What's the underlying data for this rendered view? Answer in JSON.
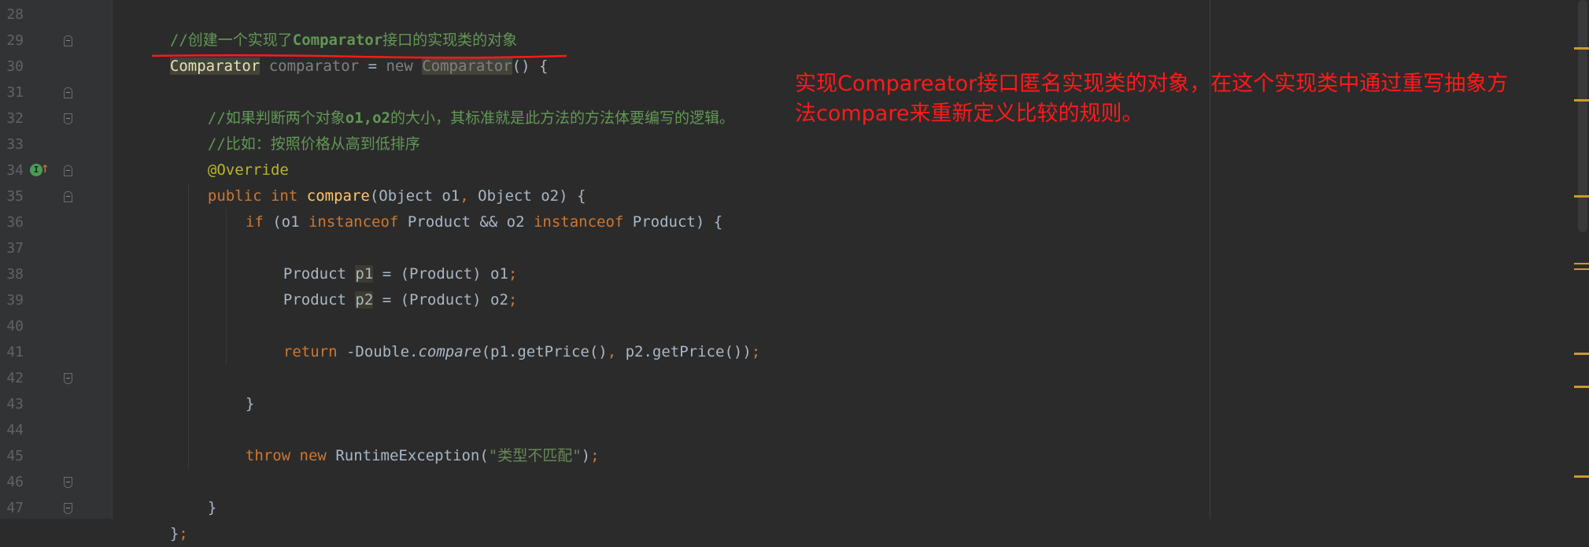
{
  "editor": {
    "line_numbers": [
      "28",
      "29",
      "30",
      "31",
      "32",
      "33",
      "34",
      "35",
      "36",
      "37",
      "38",
      "39",
      "40",
      "41",
      "42",
      "43",
      "44",
      "45",
      "46",
      "47"
    ],
    "code": {
      "l28_comment_a": "//创建一个实现了",
      "l28_comment_b": "Comparator",
      "l28_comment_c": "接口的实现类的对象",
      "l29_type": "Comparator",
      "l29_var": "comparator",
      "l29_eq": " = ",
      "l29_new": "new",
      "l29_type2": "Comparator",
      "l29_rest": "() {",
      "l31_comment_a": "//如果判断两个对象",
      "l31_comment_b": "o1,o2",
      "l31_comment_c": "的大小，其标准就是此方法的方法体要编写的逻辑。",
      "l32_comment": "//比如：按照价格从高到低排序",
      "l33_annotation": "@Override",
      "l34_public": "public",
      "l34_int": "int",
      "l34_name": "compare",
      "l34_params_a": "(Object o1",
      "l34_comma": ",",
      "l34_params_b": " Object o2) {",
      "l35_if": "if",
      "l35_a": " (o1 ",
      "l35_instanceof1": "instanceof",
      "l35_b": " Product && o2 ",
      "l35_instanceof2": "instanceof",
      "l35_c": " Product) {",
      "l37_type": "Product ",
      "l37_var": "p1",
      "l37_rest": " = (Product) o1",
      "l37_semi": ";",
      "l38_type": "Product ",
      "l38_var": "p2",
      "l38_rest": " = (Product) o2",
      "l38_semi": ";",
      "l40_return": "return",
      "l40_a": " -Double.",
      "l40_compare": "compare",
      "l40_b": "(p1.getPrice()",
      "l40_comma": ",",
      "l40_c": " p2.getPrice())",
      "l40_semi": ";",
      "l42_brace": "}",
      "l44_throw": "throw",
      "l44_new": "new",
      "l44_a": " RuntimeException(",
      "l44_str": "\"类型不匹配\"",
      "l44_b": ")",
      "l44_semi": ";",
      "l46_brace": "}",
      "l47_brace": "}",
      "l47_semi": ";"
    }
  },
  "annotation": {
    "line1": "实现Compareator接口匿名实现类的对象，在这个实现类中通过重写抽象方",
    "line2": "法compare来重新定义比较的规则。"
  },
  "colors": {
    "background": "#2b2b2b",
    "keyword": "#cc7832",
    "comment": "#629755",
    "annotation_red": "#ff1a1a"
  }
}
